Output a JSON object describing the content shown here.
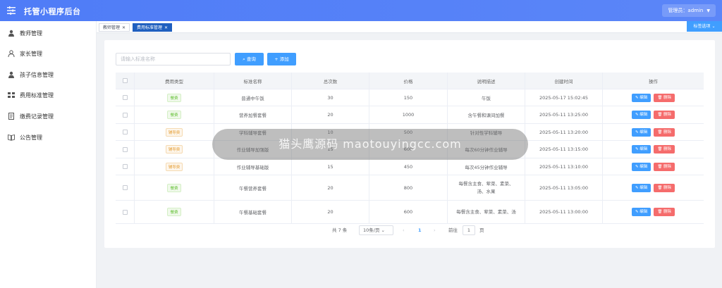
{
  "header": {
    "title": "托管小程序后台",
    "user_label": "管理员：admin"
  },
  "sidebar": {
    "items": [
      {
        "label": "教师管理",
        "icon": "user-icon"
      },
      {
        "label": "家长管理",
        "icon": "user-outline-icon"
      },
      {
        "label": "孩子信息管理",
        "icon": "user-icon"
      },
      {
        "label": "费用标准管理",
        "icon": "grid-icon"
      },
      {
        "label": "缴费记录管理",
        "icon": "document-icon"
      },
      {
        "label": "公告管理",
        "icon": "book-icon"
      }
    ]
  },
  "tabs": [
    {
      "label": "教师管理",
      "active": false
    },
    {
      "label": "费用标准管理",
      "active": true
    }
  ],
  "tab_options_label": "标签选项",
  "toolbar": {
    "search_placeholder": "请输入标准名称",
    "query_label": "查询",
    "add_label": "添加"
  },
  "table": {
    "headers": [
      "费用类型",
      "标准名称",
      "总次数",
      "价格",
      "说明描述",
      "创建时间",
      "操作"
    ],
    "edit_label": "编辑",
    "delete_label": "删除",
    "rows": [
      {
        "type": "餐费",
        "type_color": "green",
        "name": "普通中午饭",
        "count": "30",
        "price": "150",
        "desc": "午饭",
        "created": "2025-05-17 15:02:45"
      },
      {
        "type": "餐费",
        "type_color": "green",
        "name": "营养加餐套餐",
        "count": "20",
        "price": "1000",
        "desc": "含午餐和课间加餐",
        "created": "2025-05-11 13:25:00"
      },
      {
        "type": "辅导费",
        "type_color": "orange",
        "name": "学科辅导套餐",
        "count": "10",
        "price": "500",
        "desc": "针对性学科辅导",
        "created": "2025-05-11 13:20:00"
      },
      {
        "type": "辅导费",
        "type_color": "orange",
        "name": "作业辅导加强版",
        "count": "15",
        "price": "600",
        "desc": "每次60分钟作业辅导",
        "created": "2025-05-11 13:15:00"
      },
      {
        "type": "辅导费",
        "type_color": "orange",
        "name": "作业辅导基础版",
        "count": "15",
        "price": "450",
        "desc": "每次45分钟作业辅导",
        "created": "2025-05-11 13:10:00"
      },
      {
        "type": "餐费",
        "type_color": "green",
        "name": "午餐营养套餐",
        "count": "20",
        "price": "800",
        "desc": "每餐含主食、荤菜、素菜、汤、水果",
        "created": "2025-05-11 13:05:00"
      },
      {
        "type": "餐费",
        "type_color": "green",
        "name": "午餐基础套餐",
        "count": "20",
        "price": "600",
        "desc": "每餐含主食、荤菜、素菜、汤",
        "created": "2025-05-11 13:00:00"
      }
    ]
  },
  "pagination": {
    "total": "共 7 条",
    "page_size": "10条/页",
    "current": "1",
    "goto_label": "前往",
    "goto_value": "1",
    "page_unit": "页"
  },
  "watermark": "猫头鹰源码 maotouyingcc.com",
  "colors": {
    "header": "#4f7cf7",
    "primary": "#409eff",
    "danger": "#f56c6c",
    "tag_green": "#67c23a",
    "tag_orange": "#e6a23c",
    "active_tab": "#1f5fbf"
  }
}
